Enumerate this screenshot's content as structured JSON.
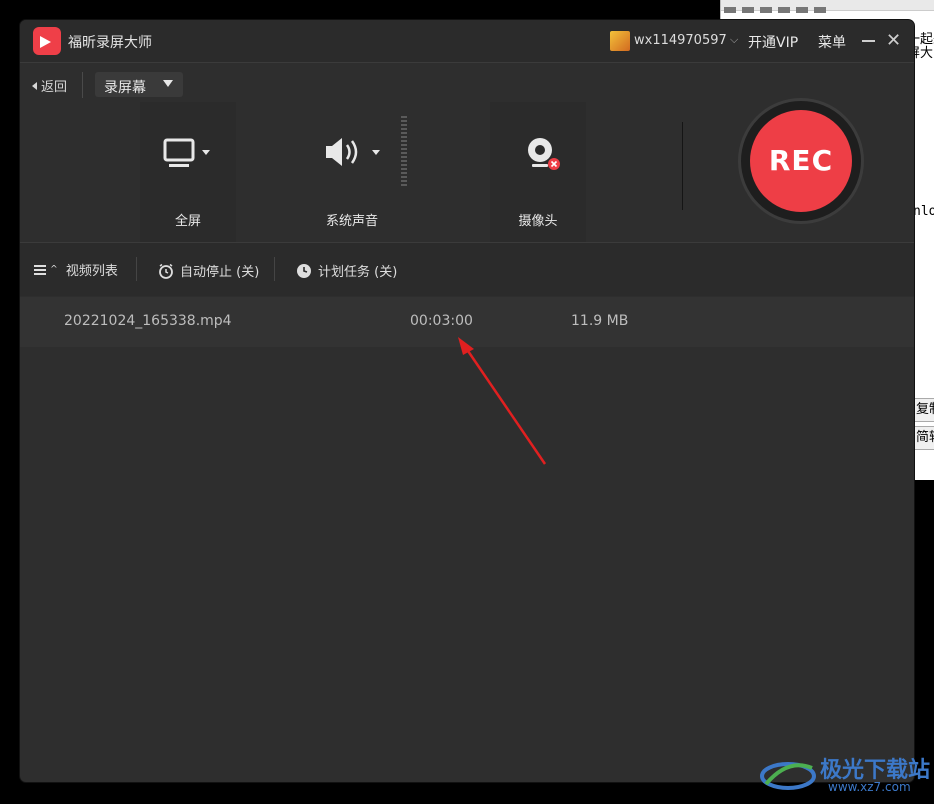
{
  "app": {
    "title": "福昕录屏大师",
    "username": "wx114970597",
    "vip_label": "开通VIP",
    "menu_label": "菜单",
    "minimize_icon": "minimize-icon",
    "close_icon": "close-icon",
    "accent_color": "#ee3e46"
  },
  "toolbar": {
    "back_label": "返回",
    "mode_label": "录屏幕"
  },
  "sources": [
    {
      "label": "全屏",
      "icon": "monitor-icon"
    },
    {
      "label": "系统声音",
      "icon": "speaker-icon"
    },
    {
      "label": "摄像头",
      "icon": "webcam-icon",
      "status": "disabled"
    }
  ],
  "rec_button": {
    "label": "REC"
  },
  "list_bar": {
    "video_list_label": "视频列表",
    "auto_stop_label": "自动停止 (关)",
    "schedule_label": "计划任务 (关)"
  },
  "files": [
    {
      "name": "20221024_165338.mp4",
      "duration": "00:03:00",
      "size": "11.9 MB"
    }
  ],
  "background_doc": {
    "lines": [
      "一起来",
      "屏大师",
      "nlo",
      "复制",
      "简转"
    ]
  },
  "watermark": {
    "text": "极光下载站",
    "url": "www.xz7.com"
  }
}
